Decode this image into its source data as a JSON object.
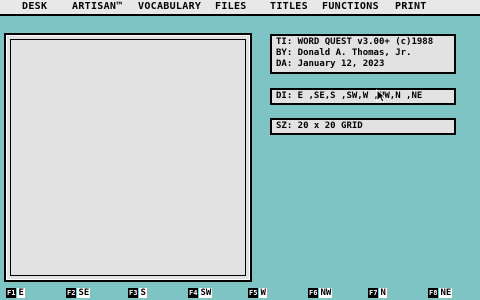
{
  "menubar": {
    "items": [
      {
        "label": "DESK"
      },
      {
        "label": "ARTISAN™"
      },
      {
        "label": "VOCABULARY"
      },
      {
        "label": "FILES"
      },
      {
        "label": "TITLES"
      },
      {
        "label": "FUNCTIONS"
      },
      {
        "label": "PRINT"
      }
    ]
  },
  "info_panel": {
    "title_line": "TI: WORD QUEST v3.00+ (c)1988",
    "author_line": "BY: Donald A. Thomas, Jr.",
    "date_line": "DA: January 12, 2023"
  },
  "directions_panel": {
    "value": "DI: E ,SE,S ,SW,W ,NW,N ,NE"
  },
  "size_panel": {
    "value": "SZ: 20 x 20 GRID"
  },
  "function_keys": [
    {
      "key": "F1",
      "label": "E"
    },
    {
      "key": "F2",
      "label": "SE"
    },
    {
      "key": "F3",
      "label": "S"
    },
    {
      "key": "F4",
      "label": "SW"
    },
    {
      "key": "F5",
      "label": "W"
    },
    {
      "key": "F6",
      "label": "NW"
    },
    {
      "key": "F7",
      "label": "N"
    },
    {
      "key": "F8",
      "label": "NE"
    }
  ],
  "colors": {
    "desktop": "#7fc4c4",
    "panel": "#e2e2e2",
    "menubar": "#e8e8e8"
  }
}
